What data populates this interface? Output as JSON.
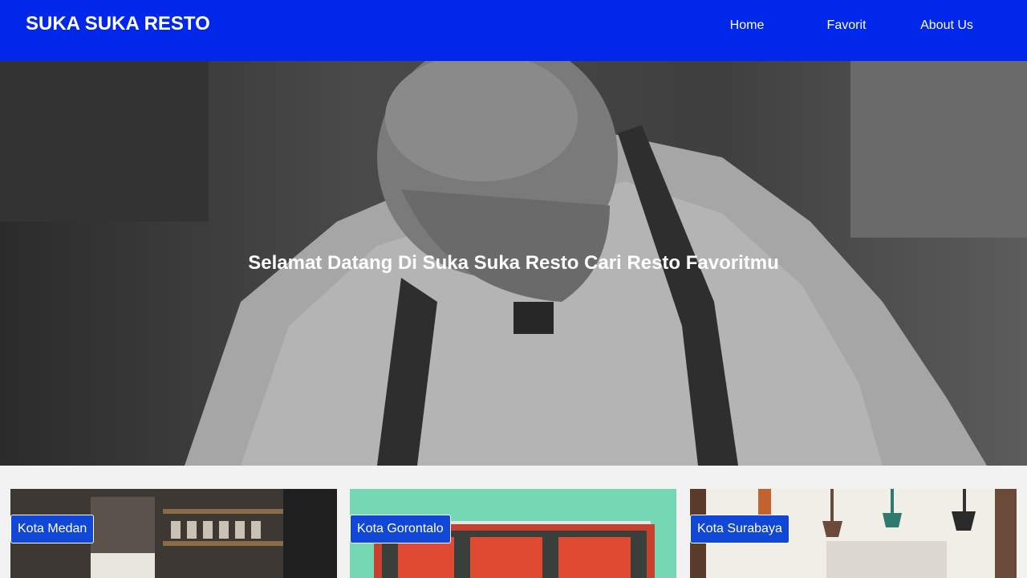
{
  "header": {
    "brand": "SUKA SUKA RESTO",
    "nav": [
      {
        "label": "Home"
      },
      {
        "label": "Favorit"
      },
      {
        "label": "About Us"
      }
    ],
    "color": "#0027ea"
  },
  "hero": {
    "title": "Selamat Datang Di Suka Suka Resto Cari Resto Favoritmu"
  },
  "cities": [
    {
      "label": "Kota Medan"
    },
    {
      "label": "Kota Gorontalo"
    },
    {
      "label": "Kota Surabaya"
    }
  ]
}
